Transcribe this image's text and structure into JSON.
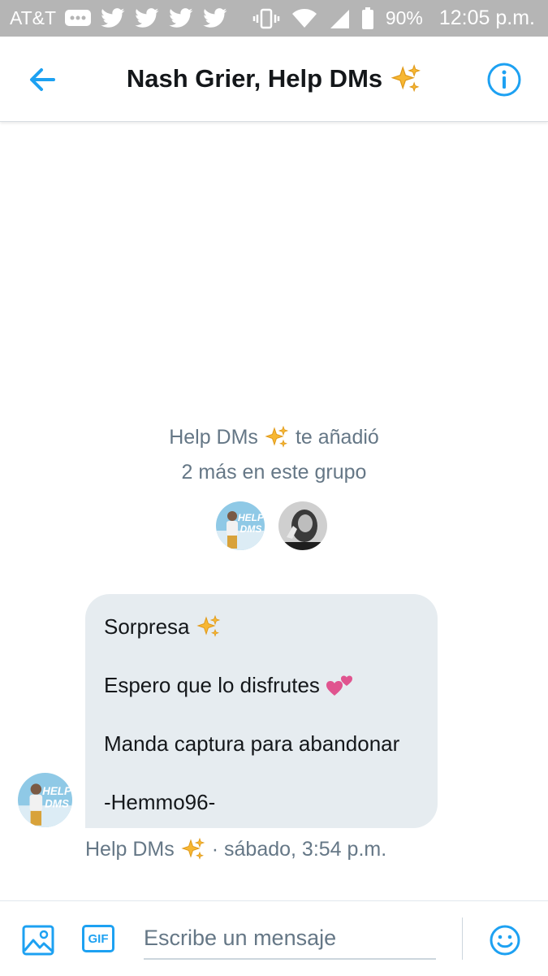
{
  "status_bar": {
    "carrier": "AT&T",
    "battery": "90%",
    "time": "12:05 p.m."
  },
  "header": {
    "title": "Nash Grier, Help DMs",
    "accent_color": "#1da1f2"
  },
  "system_event": {
    "added_by": "Help DMs",
    "added_text": "te añadió",
    "group_text": "2 más en este grupo"
  },
  "message": {
    "lines": [
      "Sorpresa",
      "Espero que lo disfrutes",
      "Manda captura para abandonar",
      "-Hemmo96-"
    ],
    "sender": "Help DMs",
    "timestamp": "· sábado, 3:54 p.m."
  },
  "composer": {
    "gif_label": "GIF",
    "placeholder": "Escribe un mensaje"
  },
  "colors": {
    "accent": "#1da1f2",
    "bubble": "#e6ecf0",
    "muted_text": "#657786",
    "status_bar": "#b5b5b5"
  }
}
